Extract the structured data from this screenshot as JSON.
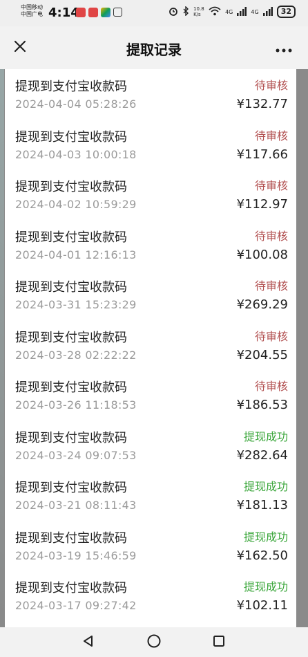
{
  "status_bar": {
    "carrier_line1": "中国移动",
    "carrier_line2": "中国广电",
    "time": "4:14",
    "network_speed": "10.8 K/s",
    "signal1": "4G",
    "signal2": "4G",
    "battery": "32"
  },
  "header": {
    "title": "提取记录",
    "close_icon": "close-icon",
    "more_icon": "more-icon"
  },
  "colors": {
    "pending": "#b25050",
    "success": "#3aa63a"
  },
  "records": [
    {
      "title": "提现到支付宝收款码",
      "time": "2024-04-04 05:28:26",
      "status": "待审核",
      "status_type": "pending",
      "amount": "¥132.77"
    },
    {
      "title": "提现到支付宝收款码",
      "time": "2024-04-03 10:00:18",
      "status": "待审核",
      "status_type": "pending",
      "amount": "¥117.66"
    },
    {
      "title": "提现到支付宝收款码",
      "time": "2024-04-02 10:59:29",
      "status": "待审核",
      "status_type": "pending",
      "amount": "¥112.97"
    },
    {
      "title": "提现到支付宝收款码",
      "time": "2024-04-01 12:16:13",
      "status": "待审核",
      "status_type": "pending",
      "amount": "¥100.08"
    },
    {
      "title": "提现到支付宝收款码",
      "time": "2024-03-31 15:23:29",
      "status": "待审核",
      "status_type": "pending",
      "amount": "¥269.29"
    },
    {
      "title": "提现到支付宝收款码",
      "time": "2024-03-28 02:22:22",
      "status": "待审核",
      "status_type": "pending",
      "amount": "¥204.55"
    },
    {
      "title": "提现到支付宝收款码",
      "time": "2024-03-26 11:18:53",
      "status": "待审核",
      "status_type": "pending",
      "amount": "¥186.53"
    },
    {
      "title": "提现到支付宝收款码",
      "time": "2024-03-24 09:07:53",
      "status": "提现成功",
      "status_type": "success",
      "amount": "¥282.64"
    },
    {
      "title": "提现到支付宝收款码",
      "time": "2024-03-21 08:11:43",
      "status": "提现成功",
      "status_type": "success",
      "amount": "¥181.13"
    },
    {
      "title": "提现到支付宝收款码",
      "time": "2024-03-19 15:46:59",
      "status": "提现成功",
      "status_type": "success",
      "amount": "¥162.50"
    },
    {
      "title": "提现到支付宝收款码",
      "time": "2024-03-17 09:27:42",
      "status": "提现成功",
      "status_type": "success",
      "amount": "¥102.11"
    }
  ],
  "navbar": {
    "back_icon": "back-triangle-icon",
    "home_icon": "home-circle-icon",
    "recents_icon": "recents-square-icon"
  }
}
